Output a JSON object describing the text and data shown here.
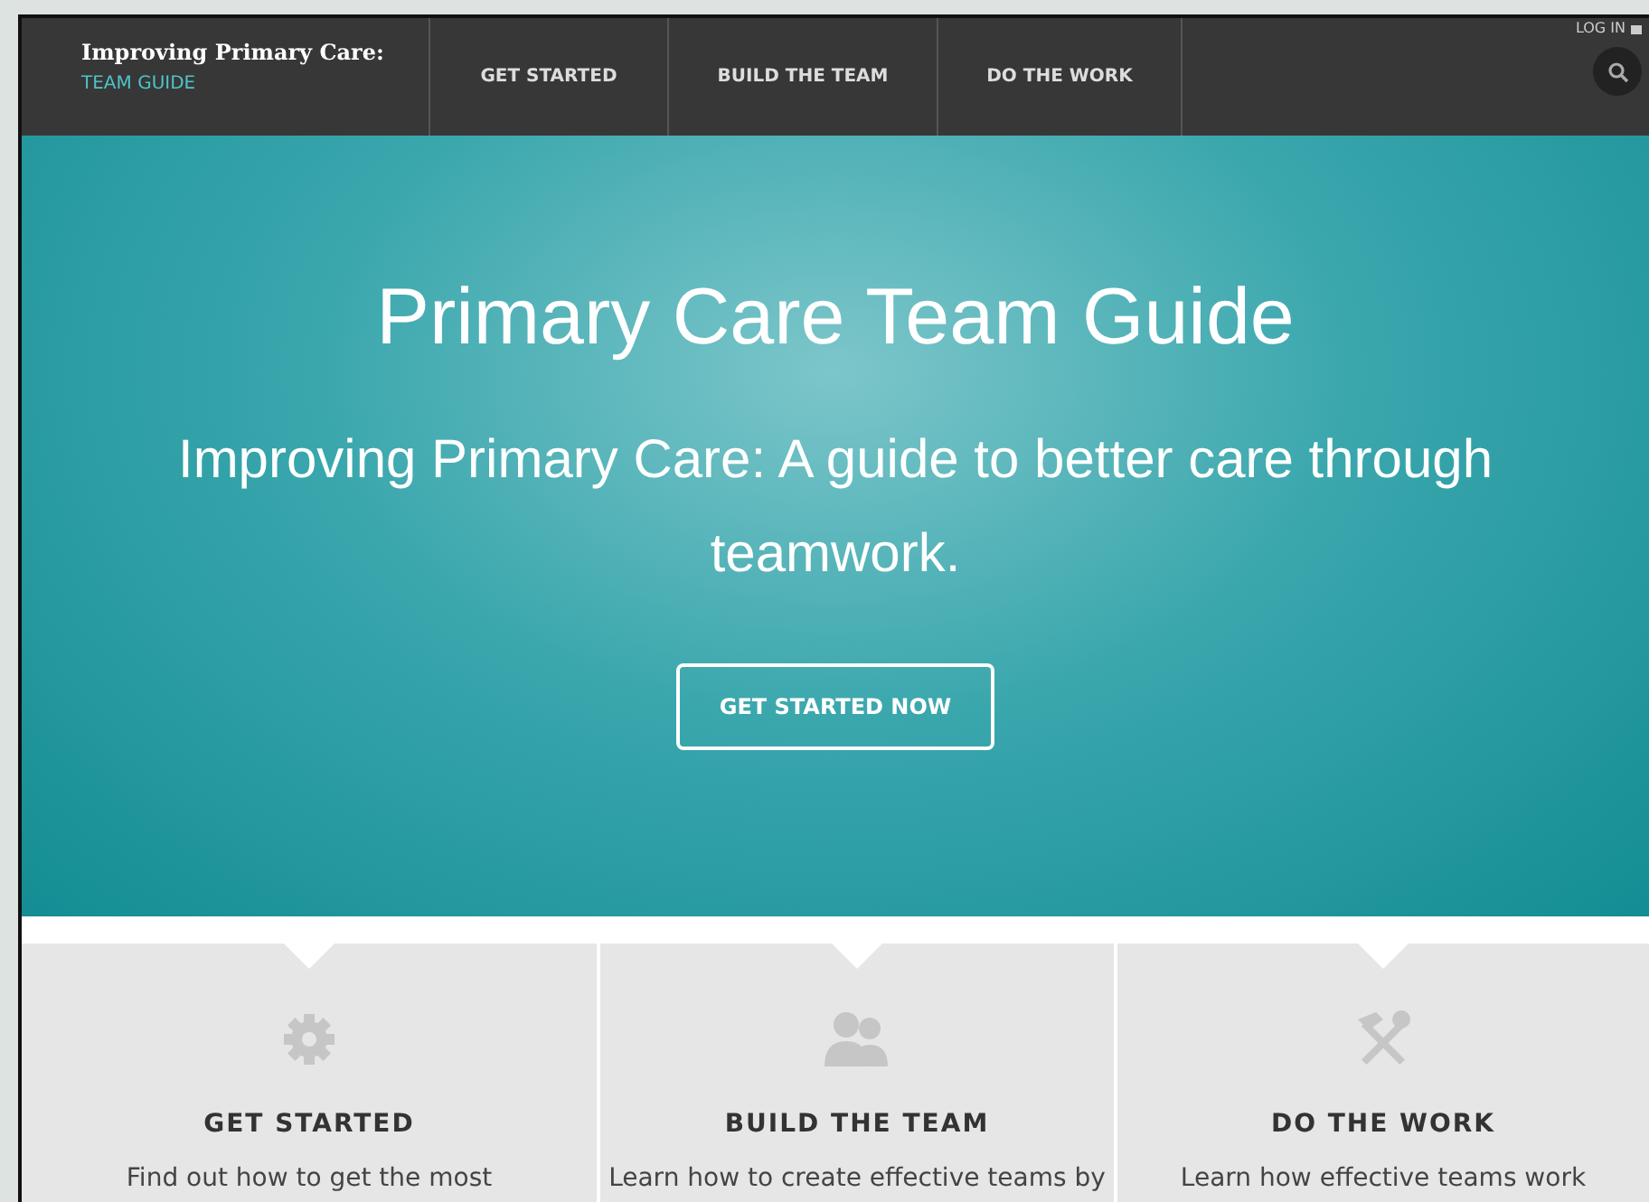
{
  "header": {
    "brand_title": "Improving Primary Care:",
    "brand_subtitle": "TEAM GUIDE",
    "nav": [
      {
        "label": "GET STARTED",
        "selected": false
      },
      {
        "label": "BUILD THE TEAM",
        "selected": false
      },
      {
        "label": "DO THE WORK",
        "selected": false
      }
    ],
    "login": "LOG IN"
  },
  "hero": {
    "title": "Primary Care Team Guide",
    "subtitle": "Improving Primary Care: A guide to better care through teamwork.",
    "button": "GET STARTED NOW"
  },
  "cards": [
    {
      "kind": "gear",
      "title": "GET STARTED",
      "text": "Find out how to get the most"
    },
    {
      "kind": "people",
      "title": "BUILD THE TEAM",
      "text": "Learn how to create effective teams by"
    },
    {
      "kind": "tools",
      "title": "DO THE WORK",
      "text": "Learn how effective teams work"
    }
  ]
}
